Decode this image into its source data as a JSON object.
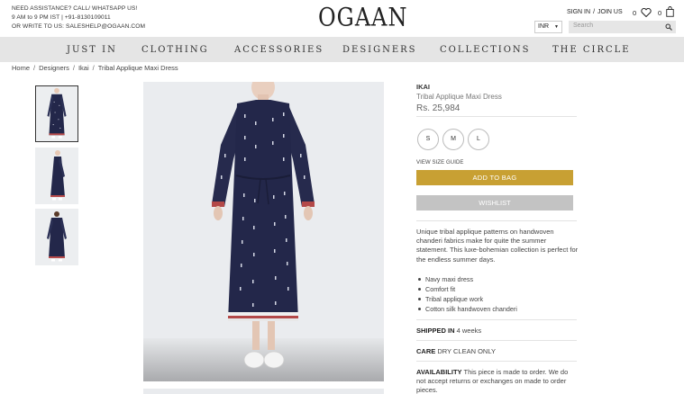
{
  "header": {
    "assistance_line1": "NEED ASSISTANCE? CALL/ WHATSAPP US!",
    "assistance_line2": "9 AM to 9 PM IST | +91-8130109011",
    "assistance_line3": "OR WRITE TO US: SALESHELP@OGAAN.COM",
    "logo": "OGAAN",
    "sign_in": "SIGN IN",
    "separator": "/",
    "join_us": "JOIN US",
    "wishlist_count": "0",
    "bag_count": "0",
    "currency": "INR",
    "search_placeholder": "Search"
  },
  "nav": [
    "JUST IN",
    "CLOTHING",
    "ACCESSORIES",
    "DESIGNERS",
    "COLLECTIONS",
    "THE CIRCLE"
  ],
  "breadcrumb": [
    "Home",
    "Designers",
    "Ikai",
    "Tribal Applique Maxi Dress"
  ],
  "product": {
    "brand": "IKAI",
    "name": "Tribal Applique Maxi Dress",
    "price": "Rs. 25,984",
    "sizes": [
      "S",
      "M",
      "L"
    ],
    "size_guide": "VIEW SIZE GUIDE",
    "add_to_bag": "ADD TO BAG",
    "wishlist": "WISHLIST",
    "description": "Unique tribal applique patterns on handwoven chanderi fabrics make for quite the summer statement. This luxe-bohemian collection is perfect for the endless summer days.",
    "features": [
      "Navy maxi dress",
      "Comfort fit",
      "Tribal applique work",
      "Cotton silk handwoven chanderi"
    ],
    "shipped_label": "SHIPPED IN",
    "shipped_value": "4 weeks",
    "care_label": "CARE",
    "care_value": "DRY CLEAN ONLY",
    "availability_label": "AVAILABILITY",
    "availability_value": "This piece is made to order. We do not accept returns or exchanges on made to order pieces."
  },
  "colors": {
    "accent_gold": "#c8a033",
    "wishlist_grey": "#c3c3c3",
    "nav_bg": "#e5e5e5",
    "dress_navy": "#23274a"
  },
  "icons": [
    "heart-icon",
    "bag-icon",
    "search-icon",
    "caret-down-icon"
  ]
}
